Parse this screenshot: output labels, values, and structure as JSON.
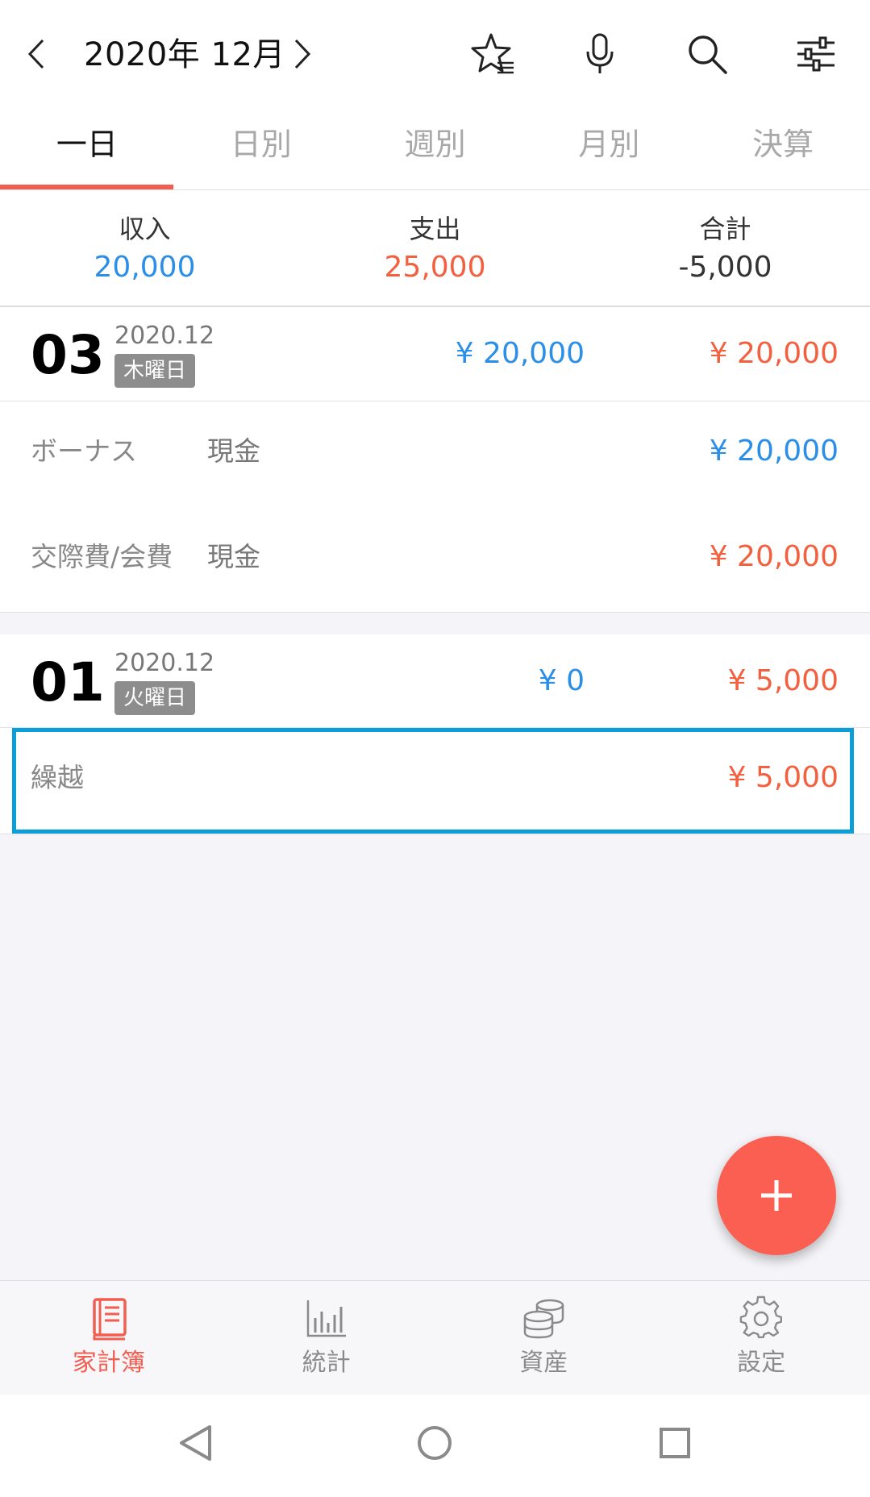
{
  "header": {
    "month_label": "2020年 12月",
    "prev_icon": "chevron-left-icon",
    "next_icon": "chevron-right-icon",
    "actions": [
      "star-list-icon",
      "microphone-icon",
      "search-icon",
      "filter-sliders-icon"
    ]
  },
  "tabs": [
    {
      "label": "一日",
      "active": true
    },
    {
      "label": "日別",
      "active": false
    },
    {
      "label": "週別",
      "active": false
    },
    {
      "label": "月別",
      "active": false
    },
    {
      "label": "決算",
      "active": false
    }
  ],
  "summary": {
    "income_label": "収入",
    "income_value": "20,000",
    "expense_label": "支出",
    "expense_value": "25,000",
    "total_label": "合計",
    "total_value": "-5,000"
  },
  "days": [
    {
      "day": "03",
      "year_month": "2020.12",
      "weekday": "木曜日",
      "income": "¥ 20,000",
      "expense": "¥ 20,000",
      "transactions": [
        {
          "category": "ボーナス",
          "account": "現金",
          "amount": "¥ 20,000",
          "type": "income"
        },
        {
          "category": "交際費/会費",
          "account": "現金",
          "amount": "¥ 20,000",
          "type": "expense"
        }
      ]
    },
    {
      "day": "01",
      "year_month": "2020.12",
      "weekday": "火曜日",
      "income": "¥ 0",
      "expense": "¥ 5,000",
      "transactions": [
        {
          "category": "繰越",
          "account": "",
          "amount": "¥ 5,000",
          "type": "expense"
        }
      ]
    }
  ],
  "fab_icon": "plus-icon",
  "bottom_nav": [
    {
      "label": "家計簿",
      "icon": "book-icon",
      "active": true
    },
    {
      "label": "統計",
      "icon": "bar-chart-icon",
      "active": false
    },
    {
      "label": "資産",
      "icon": "coins-icon",
      "active": false
    },
    {
      "label": "設定",
      "icon": "gear-icon",
      "active": false
    }
  ],
  "system_nav": [
    "back-triangle-icon",
    "home-circle-icon",
    "recents-square-icon"
  ],
  "colors": {
    "accent": "#f25d50",
    "income": "#2b8fe8",
    "expense": "#f2603f",
    "highlight": "#0a9fd8"
  }
}
